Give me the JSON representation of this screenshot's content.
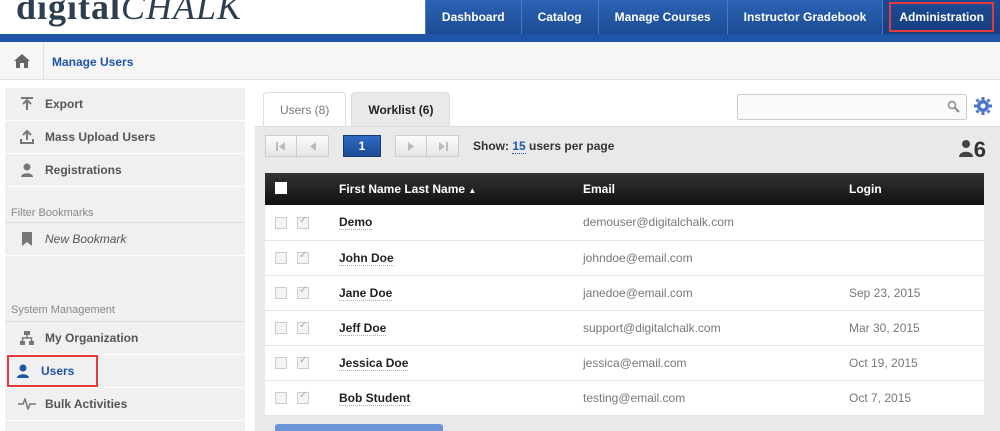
{
  "header": {
    "logo_left": "digital",
    "logo_right": "CHALK",
    "nav": [
      "Dashboard",
      "Catalog",
      "Manage Courses",
      "Instructor Gradebook",
      "Administration"
    ],
    "active_nav": "Administration"
  },
  "breadcrumb": {
    "title": "Manage Users"
  },
  "sidebar": {
    "actions": [
      {
        "label": "Export",
        "icon": "export-icon"
      },
      {
        "label": "Mass Upload Users",
        "icon": "upload-icon"
      },
      {
        "label": "Registrations",
        "icon": "registrations-icon"
      }
    ],
    "bookmarks_heading": "Filter Bookmarks",
    "new_bookmark": "New Bookmark",
    "system_heading": "System Management",
    "system_items": [
      {
        "label": "My Organization",
        "icon": "organization-icon"
      },
      {
        "label": "Users",
        "icon": "user-icon"
      },
      {
        "label": "Bulk Activities",
        "icon": "activity-icon"
      }
    ]
  },
  "main": {
    "tabs": [
      "Users (8)",
      "Worklist (6)"
    ],
    "search_placeholder": "",
    "pager": {
      "current_page": "1",
      "show_prefix": "Show:",
      "per_page": "15",
      "show_suffix": "users per page"
    },
    "user_count": "6",
    "columns": [
      "First Name Last Name",
      "Email",
      "Login"
    ],
    "rows": [
      {
        "name": "Demo",
        "email": "demouser@digitalchalk.com",
        "login": ""
      },
      {
        "name": "John Doe",
        "email": "johndoe@email.com",
        "login": ""
      },
      {
        "name": "Jane Doe",
        "email": "janedoe@email.com",
        "login": "Sep 23, 2015"
      },
      {
        "name": "Jeff Doe",
        "email": "support@digitalchalk.com",
        "login": "Mar 30, 2015"
      },
      {
        "name": "Jessica Doe",
        "email": "jessica@email.com",
        "login": "Oct 19, 2015"
      },
      {
        "name": "Bob Student",
        "email": "testing@email.com",
        "login": "Oct 7, 2015"
      }
    ]
  },
  "colors": {
    "brand_blue": "#1e55a8",
    "highlight_red": "#e23b3b"
  }
}
